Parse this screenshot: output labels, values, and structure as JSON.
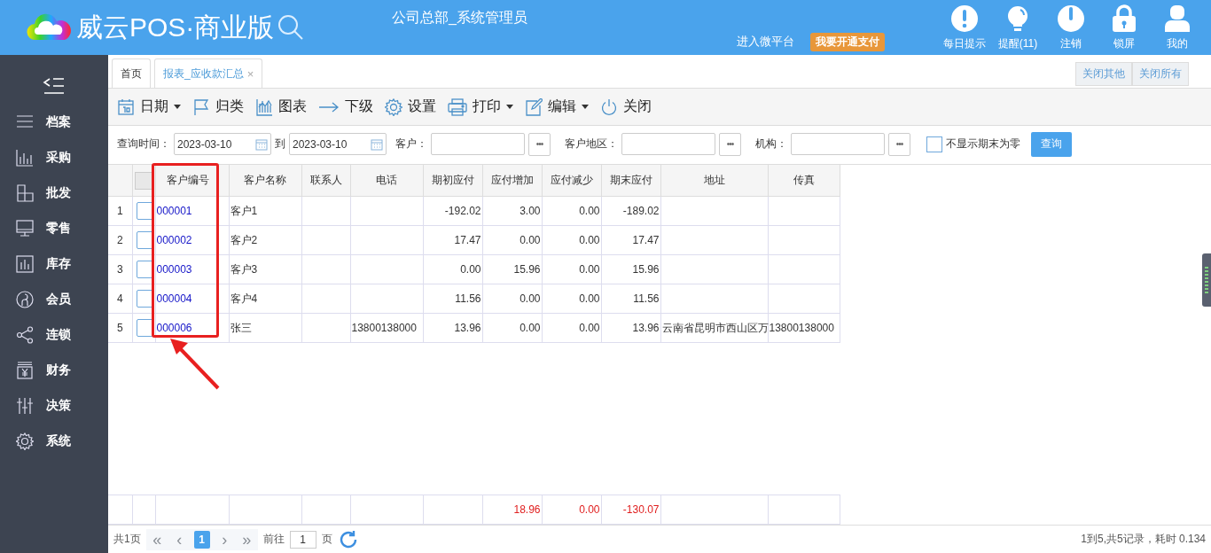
{
  "header": {
    "brand": "威云POS·商业版",
    "org": "公司总部_系统管理员",
    "links": [
      {
        "label": "进入微平台",
        "kind": "link"
      },
      {
        "label": "我要开通支付",
        "kind": "badge"
      }
    ],
    "actions": [
      {
        "label": "每日提示",
        "kind": "tip"
      },
      {
        "label": "提醒(11)",
        "kind": "bulb"
      },
      {
        "label": "注销",
        "kind": "power"
      },
      {
        "label": "锁屏",
        "kind": "lock"
      },
      {
        "label": "我的",
        "kind": "user"
      }
    ]
  },
  "sidebar": {
    "items": [
      {
        "label": "档案",
        "kind": "list"
      },
      {
        "label": "采购",
        "kind": "bars"
      },
      {
        "label": "批发",
        "kind": "blocks"
      },
      {
        "label": "零售",
        "kind": "monitor"
      },
      {
        "label": "库存",
        "kind": "stock"
      },
      {
        "label": "会员",
        "kind": "member"
      },
      {
        "label": "连锁",
        "kind": "share"
      },
      {
        "label": "财务",
        "kind": "money"
      },
      {
        "label": "决策",
        "kind": "sliders"
      },
      {
        "label": "系统",
        "kind": "gear"
      }
    ]
  },
  "tabs": [
    {
      "label": "首页",
      "selected": false
    },
    {
      "label": "报表_应收款汇总",
      "selected": true,
      "close": "×"
    }
  ],
  "tab_actions": [
    "关闭其他",
    "关闭所有"
  ],
  "toolbar": [
    {
      "label": "日期",
      "kind": "calendar",
      "dropdown": true
    },
    {
      "label": "归类",
      "kind": "flag",
      "dropdown": false
    },
    {
      "label": "图表",
      "kind": "chart",
      "dropdown": false
    },
    {
      "label": "下级",
      "kind": "arrow",
      "dropdown": false
    },
    {
      "label": "设置",
      "kind": "gear",
      "dropdown": false
    },
    {
      "label": "打印",
      "kind": "printer",
      "dropdown": true
    },
    {
      "label": "编辑",
      "kind": "edit",
      "dropdown": true
    },
    {
      "label": "关闭",
      "kind": "power",
      "dropdown": false
    }
  ],
  "filters": {
    "date_label": "查询时间：",
    "date_from": "2023-03-10",
    "date_sep": "到",
    "date_to": "2023-03-10",
    "fields": [
      {
        "label": "客户："
      },
      {
        "label": "客户地区："
      },
      {
        "label": "机构："
      }
    ],
    "more": "•••",
    "hide_zero": {
      "label": "不显示期末为零",
      "checked": false
    },
    "query": "查询"
  },
  "table": {
    "select_all": {
      "checked": false
    },
    "columns": [
      {
        "label": "客户编号",
        "kind": "link"
      },
      {
        "label": "客户名称",
        "kind": "text"
      },
      {
        "label": "联系人",
        "kind": "text"
      },
      {
        "label": "电话",
        "kind": "text"
      },
      {
        "label": "期初应付",
        "kind": "number"
      },
      {
        "label": "应付增加",
        "kind": "number"
      },
      {
        "label": "应付减少",
        "kind": "number"
      },
      {
        "label": "期末应付",
        "kind": "number"
      },
      {
        "label": "地址",
        "kind": "text"
      },
      {
        "label": "传真",
        "kind": "text"
      }
    ],
    "rows": [
      {
        "index": "1",
        "checked": false,
        "code": "000001",
        "name": "客户1",
        "opening": "-192.02",
        "increase": "3.00",
        "decrease": "0.00",
        "closing": "-189.02"
      },
      {
        "index": "2",
        "checked": false,
        "code": "000002",
        "name": "客户2",
        "opening": "17.47",
        "increase": "0.00",
        "decrease": "0.00",
        "closing": "17.47"
      },
      {
        "index": "3",
        "checked": false,
        "code": "000003",
        "name": "客户3",
        "opening": "0.00",
        "increase": "15.96",
        "decrease": "0.00",
        "closing": "15.96"
      },
      {
        "index": "4",
        "checked": false,
        "code": "000004",
        "name": "客户4",
        "opening": "11.56",
        "increase": "0.00",
        "decrease": "0.00",
        "closing": "11.56"
      },
      {
        "index": "5",
        "checked": false,
        "code": "000006",
        "name": "张三",
        "phone": "13800138000",
        "opening": "13.96",
        "increase": "0.00",
        "decrease": "0.00",
        "closing": "13.96",
        "address": "云南省昆明市西山区万",
        "fax": "13800138000"
      }
    ],
    "totals": {
      "increase": "18.96",
      "decrease": "0.00",
      "closing": "-130.07"
    }
  },
  "pager": {
    "pages": "共1页",
    "first": "«",
    "prev": "‹",
    "page": "1",
    "next": "›",
    "last": "»",
    "goto": "前往",
    "goto_value": "1",
    "unit": "页",
    "summary": "1到5,共5记录，耗时 0.134"
  }
}
